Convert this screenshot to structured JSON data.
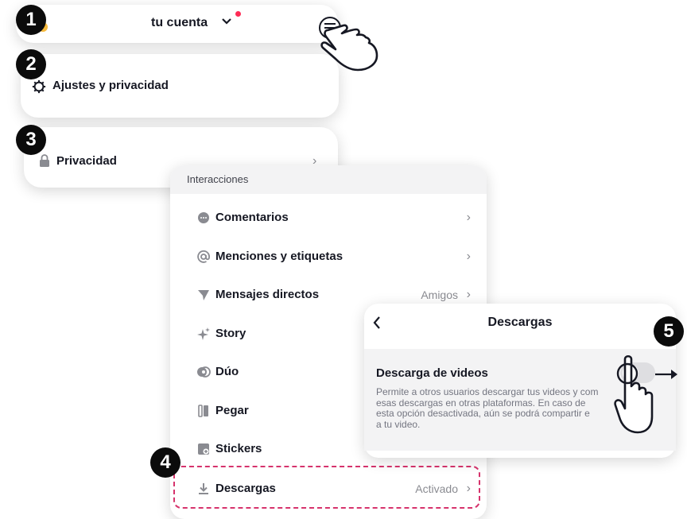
{
  "steps": [
    "1",
    "2",
    "3",
    "4",
    "5"
  ],
  "profile_header": {
    "title": "tu cuenta",
    "menu_icon": "hamburger-menu-icon"
  },
  "settings_card": {
    "label": "Ajustes y privacidad",
    "icon": "gear-icon"
  },
  "privacy_card": {
    "label": "Privacidad",
    "icon": "lock-icon"
  },
  "interactions": {
    "header": "Interacciones",
    "items": [
      {
        "label": "Comentarios",
        "value": "",
        "icon": "comment-icon"
      },
      {
        "label": "Menciones y etiquetas",
        "value": "",
        "icon": "at-icon"
      },
      {
        "label": "Mensajes directos",
        "value": "Amigos",
        "icon": "send-icon"
      },
      {
        "label": "Story",
        "value": "",
        "icon": "sparkle-icon"
      },
      {
        "label": "Dúo",
        "value": "",
        "icon": "duet-icon"
      },
      {
        "label": "Pegar",
        "value": "",
        "icon": "stitch-icon"
      },
      {
        "label": "Stickers",
        "value": "",
        "icon": "sticker-icon"
      },
      {
        "label": "Descargas",
        "value": "Activado",
        "icon": "download-icon"
      }
    ]
  },
  "downloads_panel": {
    "title": "Descargas",
    "setting_title": "Descarga de videos",
    "description": "Permite a otros usuarios descargar tus videos y com\nesas descargas en otras plataformas. En caso de\nesta opción desactivada, aún se podrá compartir e\na tu video.",
    "toggle_state": "off"
  },
  "colors": {
    "accent_dot": "#fe2c55",
    "dashed_highlight": "#d6336c",
    "step_badge": "#0b0b0b"
  }
}
